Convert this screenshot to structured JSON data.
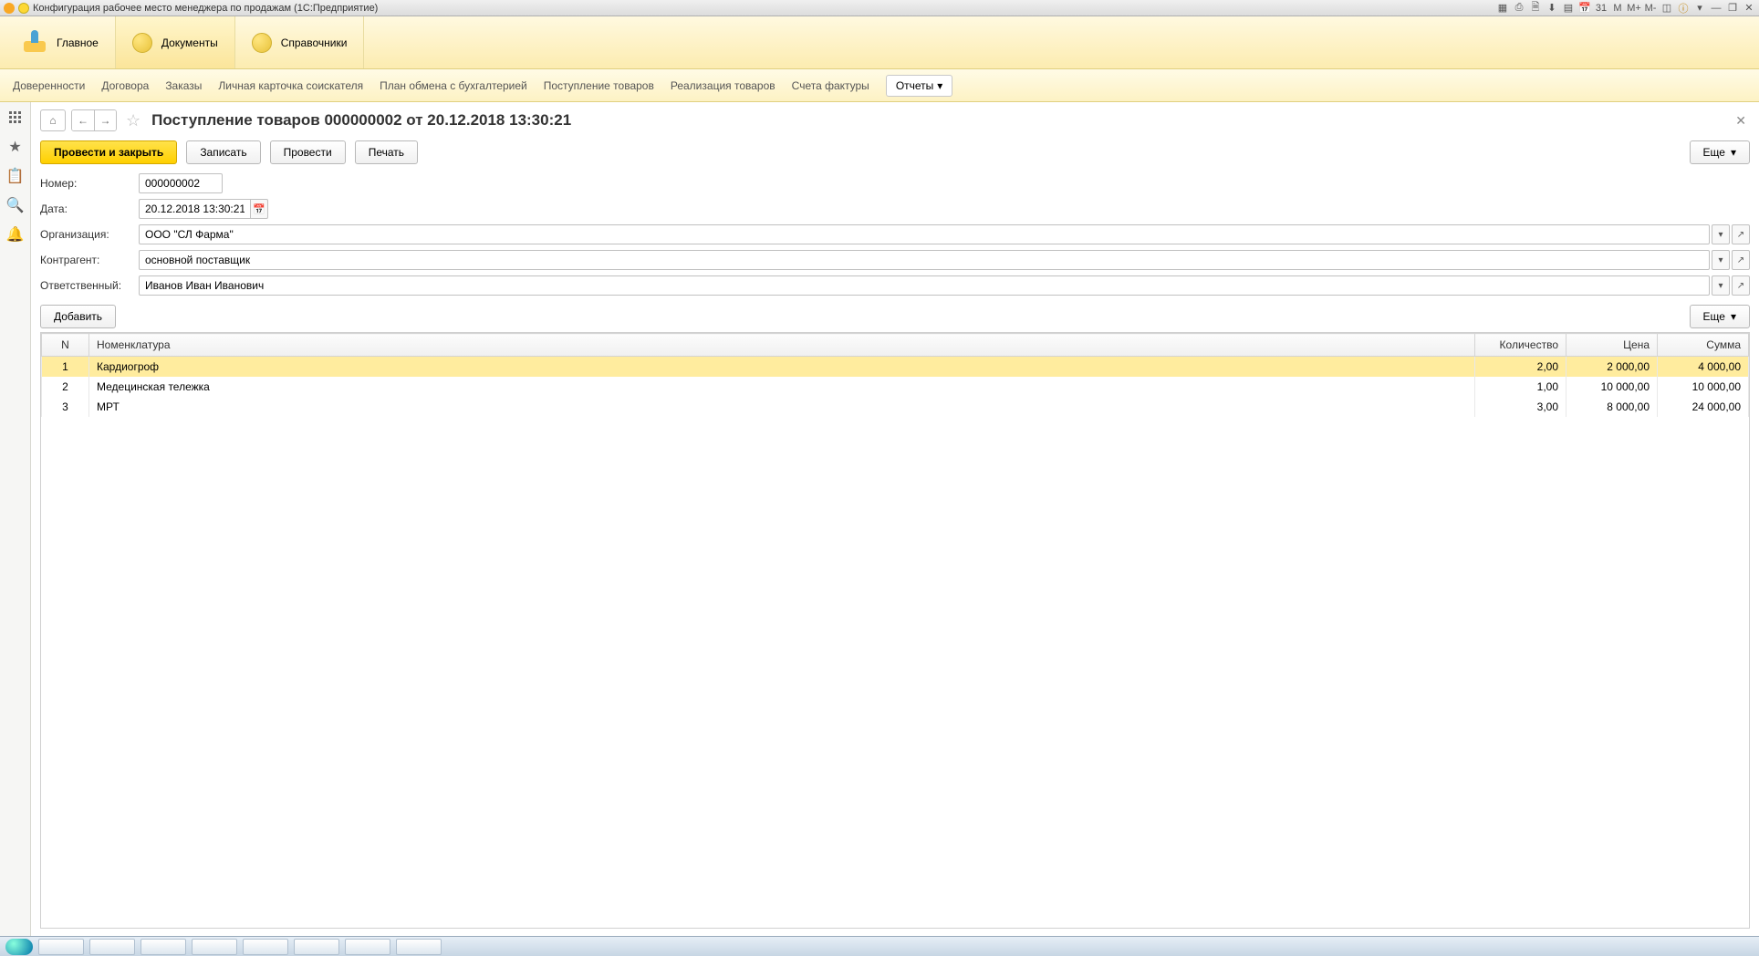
{
  "titlebar": {
    "text": "Конфигурация рабочее место менеджера по продажам  (1С:Предприятие)",
    "right_text_buttons": [
      "M",
      "M+",
      "M-"
    ]
  },
  "sections": {
    "main": "Главное",
    "documents": "Документы",
    "references": "Справочники"
  },
  "subnav": {
    "doverennosti": "Доверенности",
    "dogovora": "Договора",
    "zakazy": "Заказы",
    "lichnaya": "Личная  карточка соискателя",
    "plan": "План обмена с бухгалтерией",
    "postuplenie": "Поступление товаров",
    "realizatsiya": "Реализация товаров",
    "scheta": "Счета фактуры",
    "otchety": "Отчеты"
  },
  "doc": {
    "title": "Поступление товаров 000000002 от 20.12.2018 13:30:21",
    "buttons": {
      "post_close": "Провести и закрыть",
      "write": "Записать",
      "post": "Провести",
      "print": "Печать",
      "more": "Еще",
      "add": "Добавить"
    },
    "labels": {
      "number": "Номер:",
      "date": "Дата:",
      "org": "Организация:",
      "contragent": "Контрагент:",
      "responsible": "Ответственный:"
    },
    "values": {
      "number": "000000002",
      "date": "20.12.2018 13:30:21",
      "org": "ООО \"СЛ Фарма\"",
      "contragent": "основной поставщик",
      "responsible": "Иванов Иван Иванович"
    },
    "table": {
      "headers": {
        "n": "N",
        "nomen": "Номенклатура",
        "qty": "Количество",
        "price": "Цена",
        "sum": "Сумма"
      },
      "rows": [
        {
          "n": "1",
          "nomen": "Кардиогроф",
          "qty": "2,00",
          "price": "2 000,00",
          "sum": "4 000,00",
          "selected": true
        },
        {
          "n": "2",
          "nomen": "Медецинская тележка",
          "qty": "1,00",
          "price": "10 000,00",
          "sum": "10 000,00",
          "selected": false
        },
        {
          "n": "3",
          "nomen": "МРТ",
          "qty": "3,00",
          "price": "8 000,00",
          "sum": "24 000,00",
          "selected": false
        }
      ]
    }
  }
}
